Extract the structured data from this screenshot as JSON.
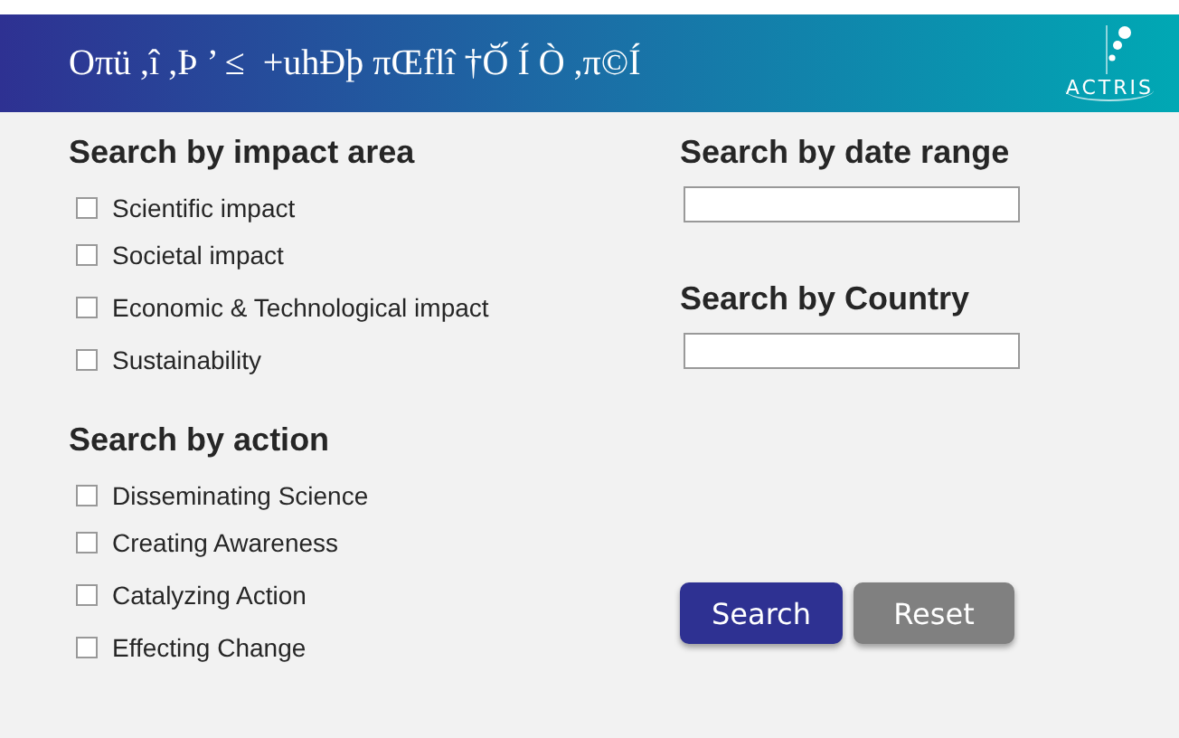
{
  "header": {
    "title": "Oπü ,î ,Þ ’ ≤  +uhĐþ πŒflî †Ŏ́ Í Ò ,π©Í",
    "logo": "ACTRIS"
  },
  "impact_area": {
    "heading": "Search by impact area",
    "options": [
      {
        "label": "Scientific impact",
        "checked": false
      },
      {
        "label": "Societal impact",
        "checked": false
      },
      {
        "label": "Economic & Technological impact",
        "checked": false
      },
      {
        "label": "Sustainability",
        "checked": false
      }
    ]
  },
  "action": {
    "heading": "Search by action",
    "options": [
      {
        "label": "Disseminating Science",
        "checked": false
      },
      {
        "label": "Creating Awareness",
        "checked": false
      },
      {
        "label": "Catalyzing Action",
        "checked": false
      },
      {
        "label": "Effecting Change",
        "checked": false
      }
    ]
  },
  "date_range": {
    "heading": "Search by date range"
  },
  "country": {
    "heading": "Search by Country"
  },
  "buttons": [
    {
      "label": "Search",
      "kind": "primary"
    },
    {
      "label": "Reset",
      "kind": "secondary"
    }
  ]
}
